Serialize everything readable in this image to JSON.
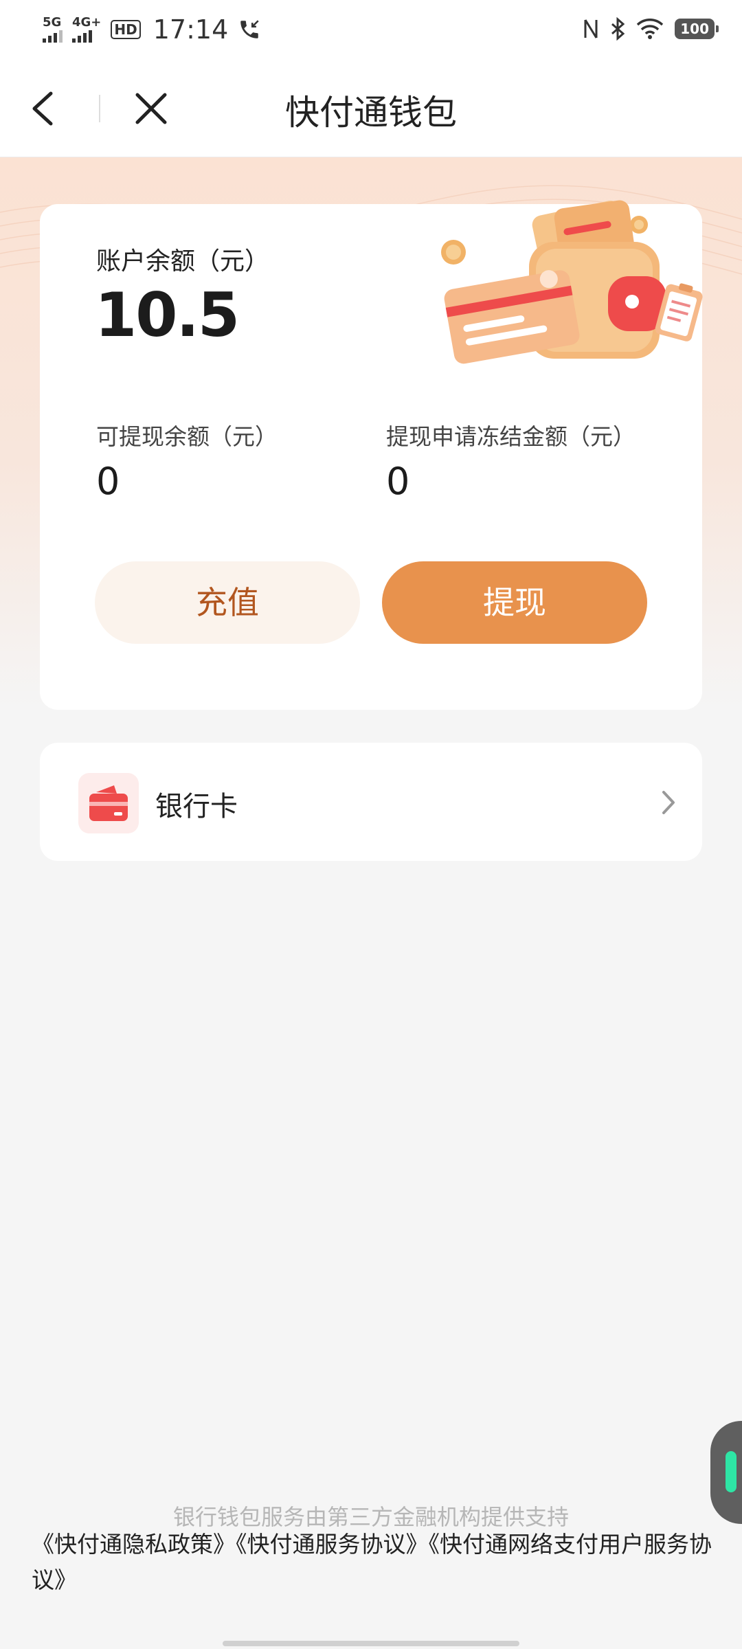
{
  "status_bar": {
    "network_1": "5G",
    "network_2": "4G+",
    "hd": "HD",
    "time": "17:14",
    "battery": "100"
  },
  "nav": {
    "title": "快付通钱包",
    "back_icon": "chevron-left-icon",
    "close_icon": "close-icon"
  },
  "balance": {
    "label": "账户余额（元）",
    "value": "10.5",
    "withdrawable_label": "可提现余额（元）",
    "withdrawable_value": "0",
    "frozen_label": "提现申请冻结金额（元）",
    "frozen_value": "0",
    "recharge_button": "充值",
    "withdraw_button": "提现"
  },
  "bank_card": {
    "label": "银行卡",
    "icon": "bank-card-icon"
  },
  "footer": {
    "note": "银行钱包服务由第三方金融机构提供支持",
    "links": [
      "《快付通隐私政策》",
      "《快付通服务协议》",
      "《快付通网络支付用户服务协议》"
    ]
  },
  "colors": {
    "accent": "#e8924d",
    "recharge_bg": "#fbf3ec",
    "recharge_text": "#b2561f"
  }
}
